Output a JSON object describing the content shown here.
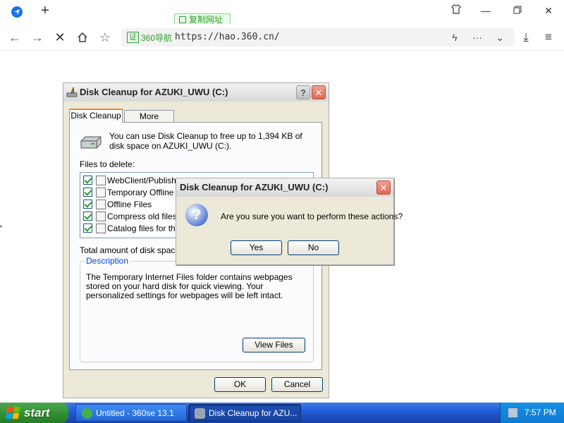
{
  "browser": {
    "copy_url_label": "复制网址",
    "cert_label": "证",
    "cert_site": "360导航",
    "url": "https://hao.360.cn/"
  },
  "main_dialog": {
    "title": "Disk Cleanup for AZUKI_UWU (C:)",
    "tabs": [
      {
        "label": "Disk Cleanup",
        "active": true
      },
      {
        "label": "More Options",
        "active": false
      }
    ],
    "intro": "You can use Disk Cleanup to free up to 1,394 KB of disk space on AZUKI_UWU (C:).",
    "files_label": "Files to delete:",
    "files": [
      {
        "name": "WebClient/Publishe",
        "checked": true
      },
      {
        "name": "Temporary Offline F",
        "checked": true
      },
      {
        "name": "Offline Files",
        "checked": true
      },
      {
        "name": "Compress old files",
        "checked": true
      },
      {
        "name": "Catalog files for the",
        "checked": true
      }
    ],
    "total_label": "Total amount of disk space y",
    "description_legend": "Description",
    "description": "The Temporary Internet Files folder contains webpages stored on your hard disk for quick viewing. Your personalized settings for webpages will be left intact.",
    "view_files_label": "View Files",
    "ok_label": "OK",
    "cancel_label": "Cancel"
  },
  "confirm_dialog": {
    "title": "Disk Cleanup for AZUKI_UWU (C:)",
    "message": "Are you sure you want to perform these actions?",
    "yes_label": "Yes",
    "no_label": "No"
  },
  "taskbar": {
    "start_label": "start",
    "tasks": [
      {
        "label": "Untitled - 360se 13.1"
      },
      {
        "label": "Disk Cleanup for AZU..."
      }
    ],
    "clock": "7:57 PM"
  },
  "colors": {
    "taskbar_blue": "#245edb",
    "start_green": "#2f8e2f",
    "xp_face": "#ece9d8",
    "close_red": "#e06a54"
  }
}
